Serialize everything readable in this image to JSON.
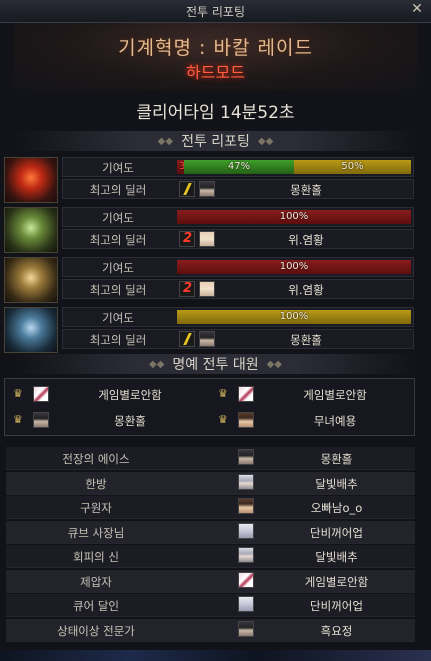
{
  "window": {
    "title": "전투 리포팅",
    "close_glyph": "✕"
  },
  "banner": {
    "raid_name": "기계혁명 : 바칼 레이드",
    "mode": "하드모드"
  },
  "clear_time": "클리어타임  14분52초",
  "report_header": "전투 리포팅",
  "honor_header": "명예 전투 대원",
  "labels": {
    "contribution": "기여도",
    "best_dealer": "최고의 딜러"
  },
  "bosses": [
    {
      "icon": "red-dragon-boss-icon",
      "segments": [
        {
          "color": "red",
          "pct": 3,
          "label": "3%"
        },
        {
          "color": "green",
          "pct": 47,
          "label": "47%"
        },
        {
          "color": "yellow",
          "pct": 50,
          "label": "50%"
        }
      ],
      "dealer": {
        "class_icon": "yellow",
        "face": "dark",
        "name": "몽환홀"
      }
    },
    {
      "icon": "green-dragon-boss-icon",
      "segments": [
        {
          "color": "red",
          "pct": 100,
          "label": "100%"
        }
      ],
      "dealer": {
        "class_icon": "red",
        "face": "light",
        "name": "위.염황"
      }
    },
    {
      "icon": "gold-dragon-boss-icon",
      "segments": [
        {
          "color": "red",
          "pct": 100,
          "label": "100%"
        }
      ],
      "dealer": {
        "class_icon": "red",
        "face": "light",
        "name": "위.염황"
      }
    },
    {
      "icon": "blue-dragon-boss-icon",
      "segments": [
        {
          "color": "yellow",
          "pct": 100,
          "label": "100%"
        }
      ],
      "dealer": {
        "class_icon": "yellow",
        "face": "dark",
        "name": "몽환홀"
      }
    }
  ],
  "honor": [
    {
      "face": "pink",
      "name": "게임별로안함"
    },
    {
      "face": "pink",
      "name": "게임별로안함"
    },
    {
      "face": "dark",
      "name": "몽환홀"
    },
    {
      "face": "brown",
      "name": "무녀예용"
    }
  ],
  "awards": [
    {
      "title": "전장의 에이스",
      "face": "dark",
      "name": "몽환홀"
    },
    {
      "title": "한방",
      "face": "silver",
      "name": "달빛배추"
    },
    {
      "title": "구원자",
      "face": "brown",
      "name": "오빠남o_o"
    },
    {
      "title": "큐브 사장님",
      "face": "bunny",
      "name": "단비꺼어업"
    },
    {
      "title": "회피의 신",
      "face": "silver",
      "name": "달빛배추"
    },
    {
      "title": "제압자",
      "face": "pink",
      "name": "게임별로안함"
    },
    {
      "title": "큐어 달인",
      "face": "bunny",
      "name": "단비꺼어업"
    },
    {
      "title": "상태이상 전문가",
      "face": "dark",
      "name": "흑요정"
    }
  ],
  "colors": {
    "red": "#8a1d1d",
    "green": "#3fa02a",
    "yellow": "#b89a18",
    "mode_text": "#ff6040"
  }
}
